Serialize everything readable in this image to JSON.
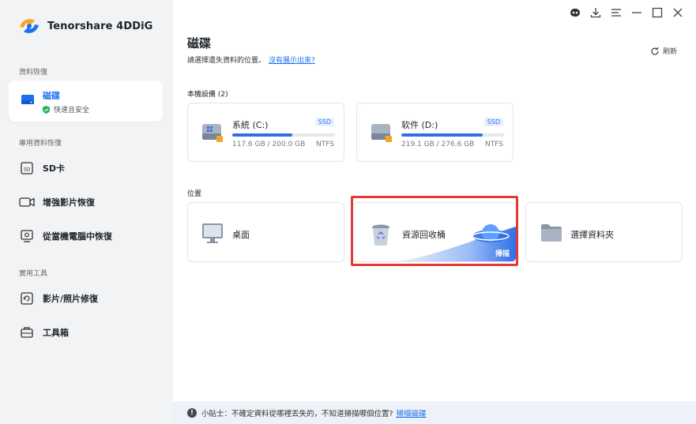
{
  "app": {
    "name": "Tenorshare 4DDiG"
  },
  "sidebar": {
    "section_recovery": "資料恢復",
    "active_item": {
      "label": "磁碟",
      "sub": "快速且安全"
    },
    "section_special": "專用資料恢復",
    "special_items": [
      {
        "label": "SD卡",
        "icon": "sd-card-icon"
      },
      {
        "label": "增強影片恢復",
        "icon": "video-camera-icon"
      },
      {
        "label": "從當機電腦中恢復",
        "icon": "crashed-computer-icon"
      }
    ],
    "section_tools": "實用工具",
    "tool_items": [
      {
        "label": "影片/照片修復",
        "icon": "photo-repair-icon"
      },
      {
        "label": "工具箱",
        "icon": "toolbox-icon"
      }
    ]
  },
  "titlebar": {
    "icons": [
      "assistant-bot-icon",
      "download-icon",
      "menu-icon",
      "minimize-icon",
      "maximize-icon",
      "close-icon"
    ]
  },
  "main": {
    "title": "磁碟",
    "subtitle": "請選擇遺失資料的位置。",
    "subtitle_link": "沒有展示出來?",
    "refresh_label": "刷新",
    "devices_label": "本機設備 (2)",
    "drives": [
      {
        "name": "系統 (C:)",
        "badge": "SSD",
        "size": "117.6 GB / 200.0 GB",
        "fs": "NTFS",
        "used_fraction": 0.588
      },
      {
        "name": "软件 (D:)",
        "badge": "SSD",
        "size": "219.1 GB / 276.6 GB",
        "fs": "NTFS",
        "used_fraction": 0.792
      }
    ],
    "locations_label": "位置",
    "locations": {
      "desktop": "桌面",
      "recycle_bin": "資源回收桶",
      "scan": "掃描",
      "folder": "選擇資料夾"
    }
  },
  "tip": {
    "text": "小貼士：不確定資料從哪裡丟失的，不知道掃描哪個位置?",
    "link": "掃描磁碟"
  },
  "colors": {
    "accent": "#1d6ff2",
    "highlight": "#e53935",
    "sidebar_bg": "#f2f3f5"
  }
}
